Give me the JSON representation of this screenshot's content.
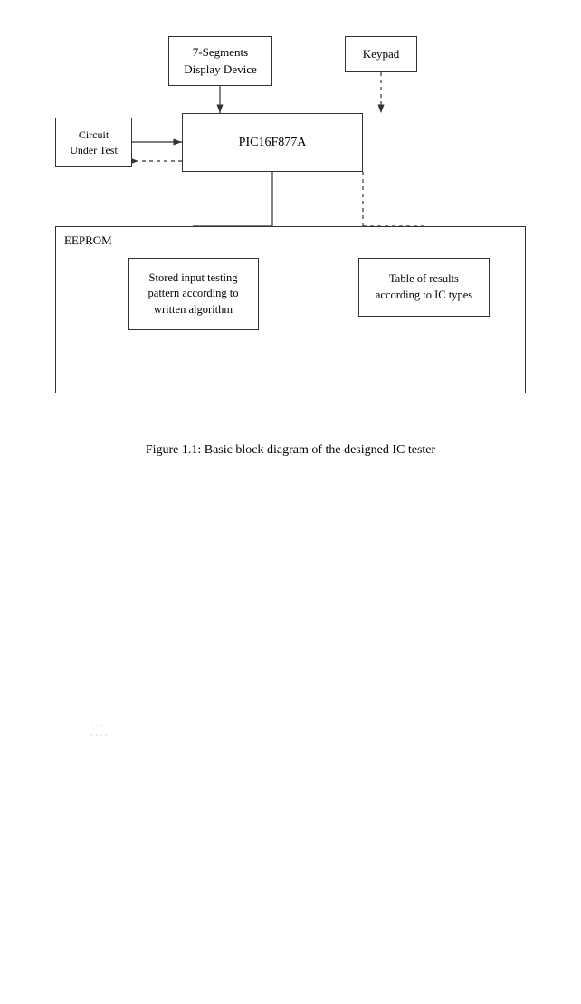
{
  "diagram": {
    "boxes": {
      "seg7": "7-Segments\nDisplay Device",
      "keypad": "Keypad",
      "pic": "PIC16F877A",
      "circuit": "Circuit\nUnder Test",
      "eeprom_label": "EEPROM",
      "stored": "Stored input testing\npattern according to\nwritten algorithm",
      "table_results": "Table of results\naccording to IC types"
    }
  },
  "figure_caption": "Figure 1.1: Basic block diagram of the designed IC tester",
  "faint_lines": [
    "·  ·  ·  ·",
    "·  ·  ·  ·"
  ]
}
